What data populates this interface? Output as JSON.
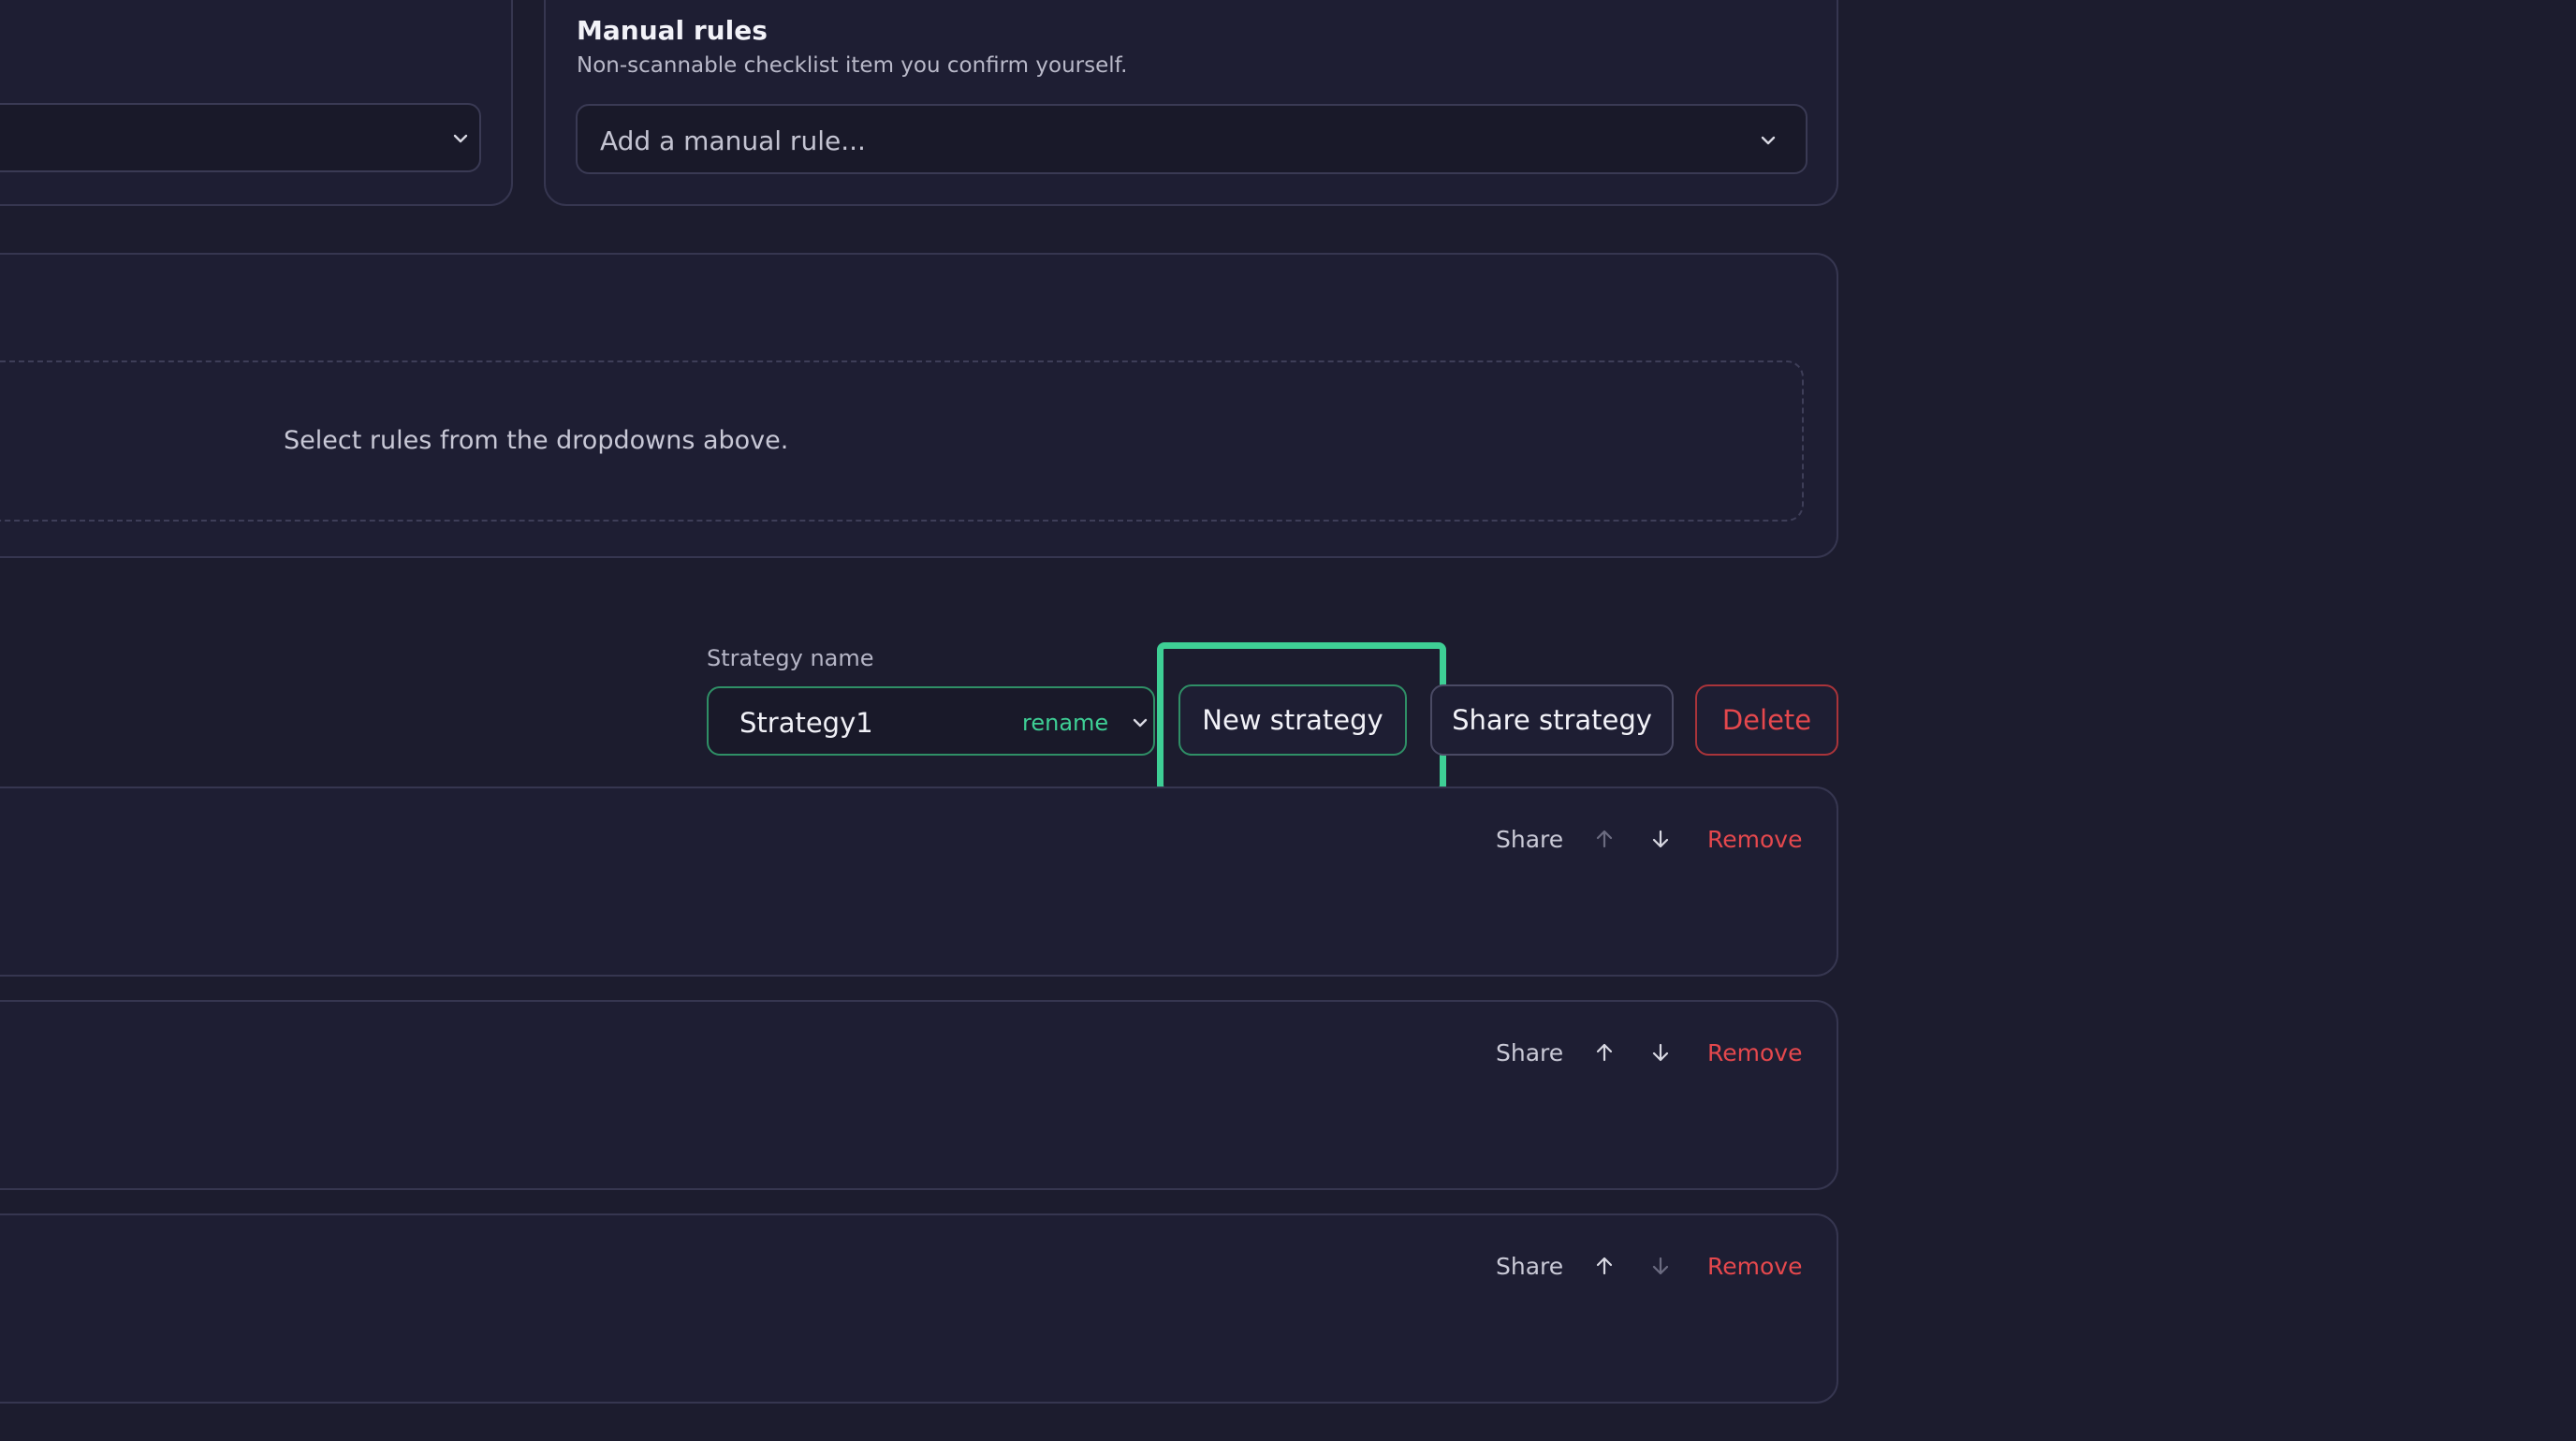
{
  "manual_rules": {
    "title": "Manual rules",
    "subtitle": "Non-scannable checklist item you confirm yourself.",
    "placeholder": "Add a manual rule..."
  },
  "rules_area": {
    "empty_text": "Select rules from the dropdowns above."
  },
  "strategy": {
    "label": "Strategy name",
    "value": "Strategy1",
    "rename_label": "rename",
    "new_label": "New strategy",
    "share_label": "Share strategy",
    "delete_label": "Delete"
  },
  "rows": [
    {
      "share": "Share",
      "remove": "Remove",
      "up_enabled": false,
      "down_enabled": true
    },
    {
      "share": "Share",
      "remove": "Remove",
      "up_enabled": true,
      "down_enabled": true
    },
    {
      "share": "Share",
      "remove": "Remove",
      "up_enabled": true,
      "down_enabled": false
    }
  ],
  "colors": {
    "accent_green": "#3ecf95",
    "danger_red": "#e5484d",
    "background": "#1c1c2e",
    "card": "#1e1e33"
  },
  "icons": [
    "chevron-down-icon",
    "arrow-up-icon",
    "arrow-down-icon"
  ]
}
